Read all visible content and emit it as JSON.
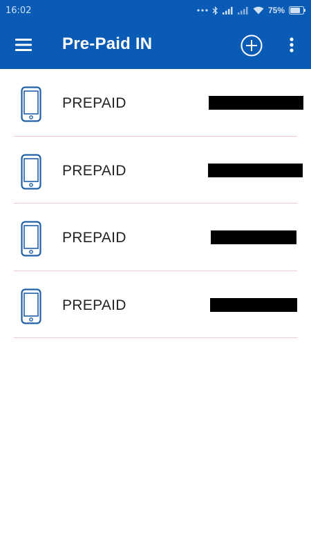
{
  "status_bar": {
    "time": "16:02",
    "battery": "75%"
  },
  "app_bar": {
    "title": "Pre-Paid IN",
    "menu_icon": "hamburger-menu-icon",
    "add_icon": "add-circle-icon",
    "overflow_icon": "more-vert-icon"
  },
  "colors": {
    "primary": "#0a5bb5",
    "icon": "#1f5fa8",
    "divider": "#f0c8cf",
    "redaction": "#000000"
  },
  "items": [
    {
      "label": "PREPAID",
      "icon": "smartphone-icon"
    },
    {
      "label": "PREPAID",
      "icon": "smartphone-icon"
    },
    {
      "label": "PREPAID",
      "icon": "smartphone-icon"
    },
    {
      "label": "PREPAID",
      "icon": "smartphone-icon"
    }
  ]
}
